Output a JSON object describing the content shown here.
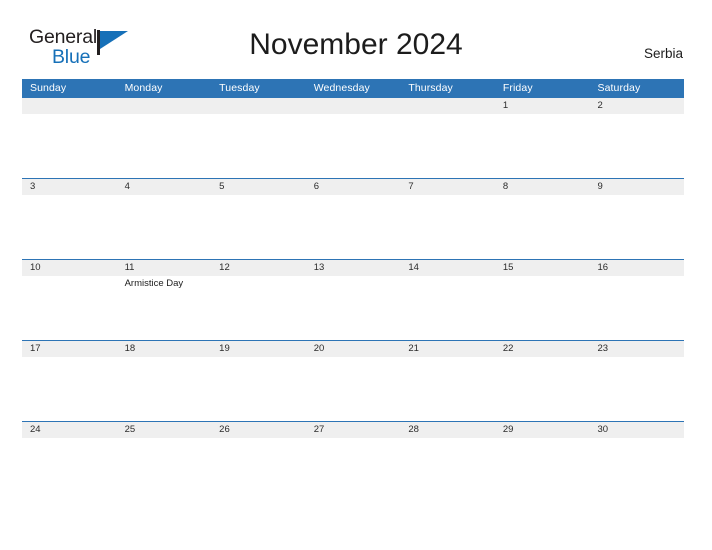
{
  "brand": {
    "name_part1": "General",
    "name_part2": "Blue",
    "flag_icon": "flag-triangle-icon",
    "colors": {
      "text_dark": "#231f20",
      "blue": "#1670b8"
    }
  },
  "header": {
    "title": "November 2024",
    "region": "Serbia"
  },
  "calendar": {
    "header_color": "#2d74b5",
    "date_band_color": "#efefef",
    "weekdays": [
      "Sunday",
      "Monday",
      "Tuesday",
      "Wednesday",
      "Thursday",
      "Friday",
      "Saturday"
    ],
    "weeks": [
      {
        "days": [
          {
            "date": "",
            "events": []
          },
          {
            "date": "",
            "events": []
          },
          {
            "date": "",
            "events": []
          },
          {
            "date": "",
            "events": []
          },
          {
            "date": "",
            "events": []
          },
          {
            "date": "1",
            "events": []
          },
          {
            "date": "2",
            "events": []
          }
        ]
      },
      {
        "days": [
          {
            "date": "3",
            "events": []
          },
          {
            "date": "4",
            "events": []
          },
          {
            "date": "5",
            "events": []
          },
          {
            "date": "6",
            "events": []
          },
          {
            "date": "7",
            "events": []
          },
          {
            "date": "8",
            "events": []
          },
          {
            "date": "9",
            "events": []
          }
        ]
      },
      {
        "days": [
          {
            "date": "10",
            "events": []
          },
          {
            "date": "11",
            "events": [
              "Armistice Day"
            ]
          },
          {
            "date": "12",
            "events": []
          },
          {
            "date": "13",
            "events": []
          },
          {
            "date": "14",
            "events": []
          },
          {
            "date": "15",
            "events": []
          },
          {
            "date": "16",
            "events": []
          }
        ]
      },
      {
        "days": [
          {
            "date": "17",
            "events": []
          },
          {
            "date": "18",
            "events": []
          },
          {
            "date": "19",
            "events": []
          },
          {
            "date": "20",
            "events": []
          },
          {
            "date": "21",
            "events": []
          },
          {
            "date": "22",
            "events": []
          },
          {
            "date": "23",
            "events": []
          }
        ]
      },
      {
        "days": [
          {
            "date": "24",
            "events": []
          },
          {
            "date": "25",
            "events": []
          },
          {
            "date": "26",
            "events": []
          },
          {
            "date": "27",
            "events": []
          },
          {
            "date": "28",
            "events": []
          },
          {
            "date": "29",
            "events": []
          },
          {
            "date": "30",
            "events": []
          }
        ]
      }
    ]
  }
}
